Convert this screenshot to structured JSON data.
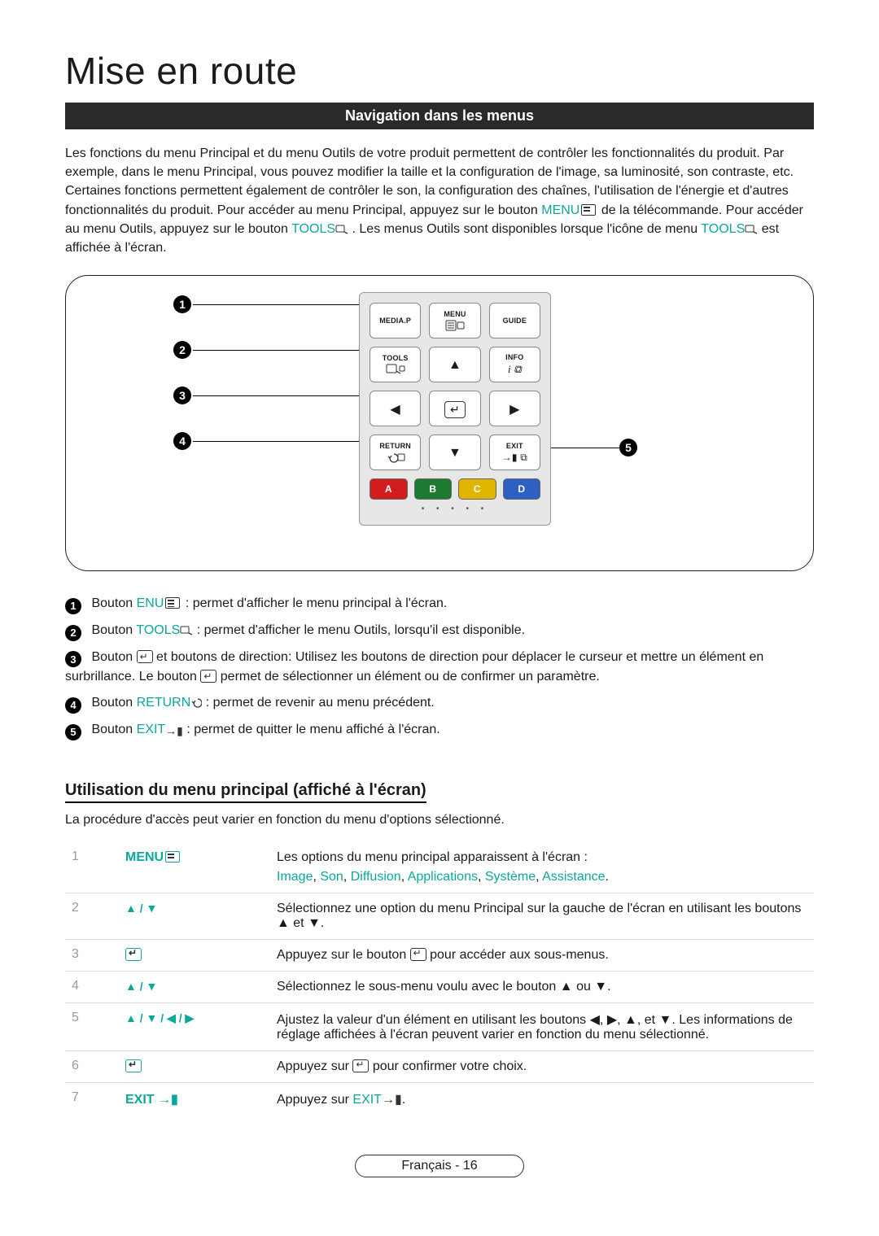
{
  "title": "Mise en route",
  "section_bar": "Navigation dans les menus",
  "intro": {
    "p1a": "Les fonctions du menu Principal et du menu Outils de votre produit permettent de contrôler les fonctionnalités du produit. Par exemple, dans le menu Principal, vous pouvez modifier la taille et la configuration de l'image, sa luminosité, son contraste, etc. Certaines fonctions permettent également de contrôler le son, la configuration des chaînes, l'utilisation de l'énergie et d'autres fonctionnalités du produit. Pour accéder au menu Principal, appuyez sur le bouton ",
    "menu_kw": "MENU",
    "p1b": " de la télécommande. Pour accéder au menu Outils, appuyez sur le bouton ",
    "tools_kw": "TOOLS",
    "p1c": ". Les menus Outils sont disponibles lorsque l'icône de menu ",
    "tools_kw2": "TOOLS",
    "p1d": " est affichée à l'écran."
  },
  "remote": {
    "mediap": "MEDIA.P",
    "menu": "MENU",
    "guide": "GUIDE",
    "tools": "TOOLS",
    "info": "INFO",
    "return": "RETURN",
    "exit": "EXIT",
    "a": "A",
    "b": "B",
    "c": "C",
    "d": "D"
  },
  "markers": {
    "m1": "1",
    "m2": "2",
    "m3": "3",
    "m4": "4",
    "m5": "5"
  },
  "explain": {
    "e1_pre": "Bouton ",
    "e1_kw": "ENU",
    "e1_post": " : permet d'afficher le menu principal à l'écran.",
    "e2_pre": "Bouton ",
    "e2_kw": "TOOLS",
    "e2_post": " : permet d'afficher le menu Outils, lorsqu'il est disponible.",
    "e3_pre": "Bouton ",
    "e3_mid": " et boutons de direction: Utilisez les boutons de direction pour déplacer le curseur et mettre un élément en surbrillance. Le bouton ",
    "e3_post": " permet de sélectionner un élément ou de confirmer un paramètre.",
    "e4_pre": "Bouton ",
    "e4_kw": "RETURN",
    "e4_post": " : permet de revenir au menu précédent.",
    "e5_pre": "Bouton ",
    "e5_kw": "EXIT",
    "e5_post": " : permet de quitter le menu affiché à l'écran."
  },
  "subsection": {
    "heading": "Utilisation du menu principal (affiché à l'écran)",
    "para": "La procédure d'accès peut varier en fonction du menu d'options sélectionné."
  },
  "steps": [
    {
      "num": "1",
      "key_text": "MENU",
      "desc_pre": "Les options du menu principal apparaissent à l'écran :",
      "links": [
        "Image",
        "Son",
        "Diffusion",
        "Applications",
        "Système",
        "Assistance"
      ],
      "desc_end": "."
    },
    {
      "num": "2",
      "key_symbols": "▲ / ▼",
      "desc_pre": "Sélectionnez une option du menu Principal sur la gauche de l'écran en utilisant les boutons ",
      "desc_mid_sym": "▲ et ▼",
      "desc_post": "."
    },
    {
      "num": "3",
      "key_enter": true,
      "desc_pre": "Appuyez sur le bouton ",
      "desc_post": " pour accéder aux sous-menus."
    },
    {
      "num": "4",
      "key_symbols": "▲ / ▼",
      "desc_pre": "Sélectionnez le sous-menu voulu avec le bouton ",
      "desc_mid_sym": "▲ ou ▼",
      "desc_post": "."
    },
    {
      "num": "5",
      "key_symbols": "▲ / ▼ / ◀ / ▶",
      "desc_pre": "Ajustez la valeur d'un élément en utilisant les boutons ",
      "desc_mid_sym": "◀, ▶, ▲, et ▼",
      "desc_post": ". Les informations de réglage affichées à l'écran peuvent varier en fonction du menu sélectionné."
    },
    {
      "num": "6",
      "key_enter": true,
      "desc_pre": "Appuyez sur ",
      "desc_post": " pour confirmer votre choix."
    },
    {
      "num": "7",
      "key_text": "EXIT ",
      "key_exit_icon": true,
      "desc_pre": "Appuyez sur ",
      "desc_kw": "EXIT",
      "desc_post": "."
    }
  ],
  "footer": "Français - 16"
}
